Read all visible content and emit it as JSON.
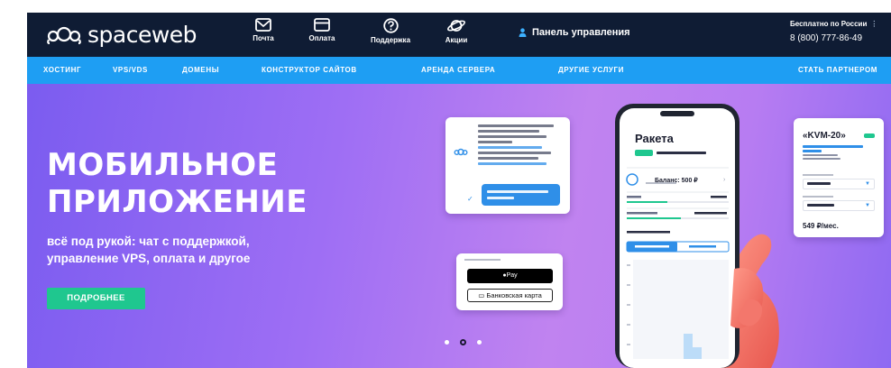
{
  "brand": {
    "name": "spaceweb"
  },
  "top_nav": [
    {
      "label": "Почта",
      "icon": "mail-icon"
    },
    {
      "label": "Оплата",
      "icon": "card-icon"
    },
    {
      "label": "Поддержка",
      "icon": "help-icon"
    },
    {
      "label": "Акции",
      "icon": "planet-icon"
    }
  ],
  "panel_link": {
    "label": "Панель управления",
    "icon": "user-icon"
  },
  "contact": {
    "caption": "Бесплатно по России",
    "phone": "8 (800) 777-86-49"
  },
  "menu": [
    {
      "label": "ХОСТИНГ"
    },
    {
      "label": "VPS/VDS"
    },
    {
      "label": "ДОМЕНЫ"
    },
    {
      "label": "КОНСТРУКТОР САЙТОВ"
    },
    {
      "label": "АРЕНДА СЕРВЕРА"
    },
    {
      "label": "ДРУГИЕ УСЛУГИ"
    },
    {
      "label": "СТАТЬ ПАРТНЕРОМ"
    }
  ],
  "hero": {
    "title_line1": "МОБИЛЬНОЕ",
    "title_line2": "ПРИЛОЖЕНИЕ",
    "subtitle_line1": "всё под рукой: чат с поддержкой,",
    "subtitle_line2": "управление VPS, оплата и другое",
    "button": "ПОДРОБНЕЕ",
    "slides": 3,
    "active_slide": 2
  },
  "phone_mockup": {
    "title": "Ракета",
    "balance": "Баланс: 500 ₽"
  },
  "payment_card": {
    "apple_pay": "Pay",
    "bank_card": "Банковская карта"
  },
  "tariff_card": {
    "name": "«KVM-20»",
    "price": "549 ₽/мес."
  },
  "colors": {
    "topbar": "#0f1c34",
    "menubar": "#1e9ef3",
    "accent_button": "#1fc78f"
  }
}
